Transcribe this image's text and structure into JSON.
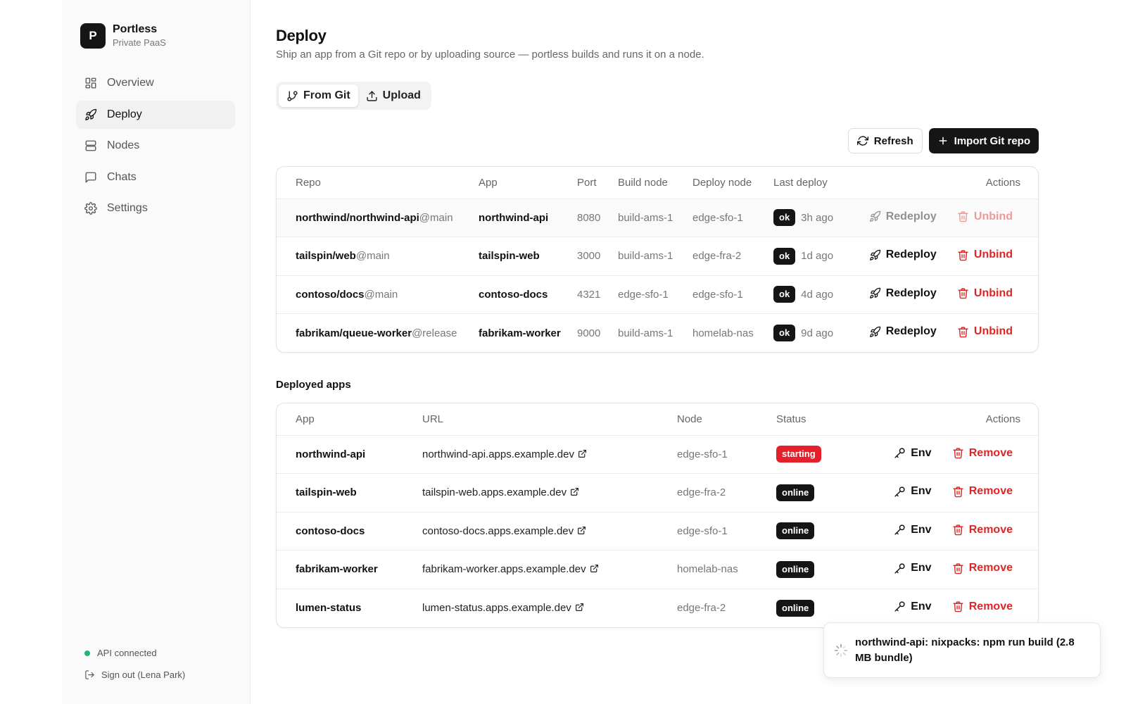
{
  "brand": {
    "logo_letter": "P",
    "name": "Portless",
    "subtitle": "Private PaaS"
  },
  "sidebar": {
    "items": [
      {
        "label": "Overview",
        "icon": "grid-icon",
        "active": false
      },
      {
        "label": "Deploy",
        "icon": "rocket-icon",
        "active": true
      },
      {
        "label": "Nodes",
        "icon": "server-icon",
        "active": false
      },
      {
        "label": "Chats",
        "icon": "chat-icon",
        "active": false
      },
      {
        "label": "Settings",
        "icon": "gear-icon",
        "active": false
      }
    ],
    "status_text": "API connected",
    "status_color": "#22b573",
    "signout_label": "Sign out (Lena Park)"
  },
  "page": {
    "title": "Deploy",
    "subtitle": "Ship an app from a Git repo or by uploading source — portless builds and runs it on a node."
  },
  "tabs": [
    {
      "label": "From Git",
      "icon": "git-branch-icon",
      "active": true
    },
    {
      "label": "Upload",
      "icon": "upload-icon",
      "active": false
    }
  ],
  "toolbar": {
    "refresh_label": "Refresh",
    "import_label": "Import Git repo"
  },
  "repos": {
    "columns": [
      "Repo",
      "App",
      "Port",
      "Build node",
      "Deploy node",
      "Last deploy",
      "Actions"
    ],
    "rows": [
      {
        "repo": "northwind/northwind-api",
        "branch": "@main",
        "app": "northwind-api",
        "port": "8080",
        "build_node": "build-ams-1",
        "deploy_node": "edge-sfo-1",
        "status": "ok",
        "last_deploy": "3h ago",
        "redeploy": "Redeploy",
        "unbind": "Unbind"
      },
      {
        "repo": "tailspin/web",
        "branch": "@main",
        "app": "tailspin-web",
        "port": "3000",
        "build_node": "build-ams-1",
        "deploy_node": "edge-fra-2",
        "status": "ok",
        "last_deploy": "1d ago",
        "redeploy": "Redeploy",
        "unbind": "Unbind"
      },
      {
        "repo": "contoso/docs",
        "branch": "@main",
        "app": "contoso-docs",
        "port": "4321",
        "build_node": "edge-sfo-1",
        "deploy_node": "edge-sfo-1",
        "status": "ok",
        "last_deploy": "4d ago",
        "redeploy": "Redeploy",
        "unbind": "Unbind"
      },
      {
        "repo": "fabrikam/queue-worker",
        "branch": "@release",
        "app": "fabrikam-worker",
        "port": "9000",
        "build_node": "build-ams-1",
        "deploy_node": "homelab-nas",
        "status": "ok",
        "last_deploy": "9d ago",
        "redeploy": "Redeploy",
        "unbind": "Unbind"
      }
    ]
  },
  "deployed": {
    "title": "Deployed apps",
    "columns": [
      "App",
      "URL",
      "Node",
      "Status",
      "Actions"
    ],
    "rows": [
      {
        "app": "northwind-api",
        "url": "northwind-api.apps.example.dev",
        "node": "edge-sfo-1",
        "status": "starting",
        "env": "Env",
        "remove": "Remove"
      },
      {
        "app": "tailspin-web",
        "url": "tailspin-web.apps.example.dev",
        "node": "edge-fra-2",
        "status": "online",
        "env": "Env",
        "remove": "Remove"
      },
      {
        "app": "contoso-docs",
        "url": "contoso-docs.apps.example.dev",
        "node": "edge-sfo-1",
        "status": "online",
        "env": "Env",
        "remove": "Remove"
      },
      {
        "app": "fabrikam-worker",
        "url": "fabrikam-worker.apps.example.dev",
        "node": "homelab-nas",
        "status": "online",
        "env": "Env",
        "remove": "Remove"
      },
      {
        "app": "lumen-status",
        "url": "lumen-status.apps.example.dev",
        "node": "edge-fra-2",
        "status": "online",
        "env": "Env",
        "remove": "Remove"
      }
    ]
  },
  "toast": {
    "text": "northwind-api: nixpacks: npm run build (2.8 MB bundle)",
    "icon": "spinner-icon"
  },
  "colors": {
    "accent": "#151515",
    "danger": "#dc2626",
    "starting": "#e5202b"
  }
}
